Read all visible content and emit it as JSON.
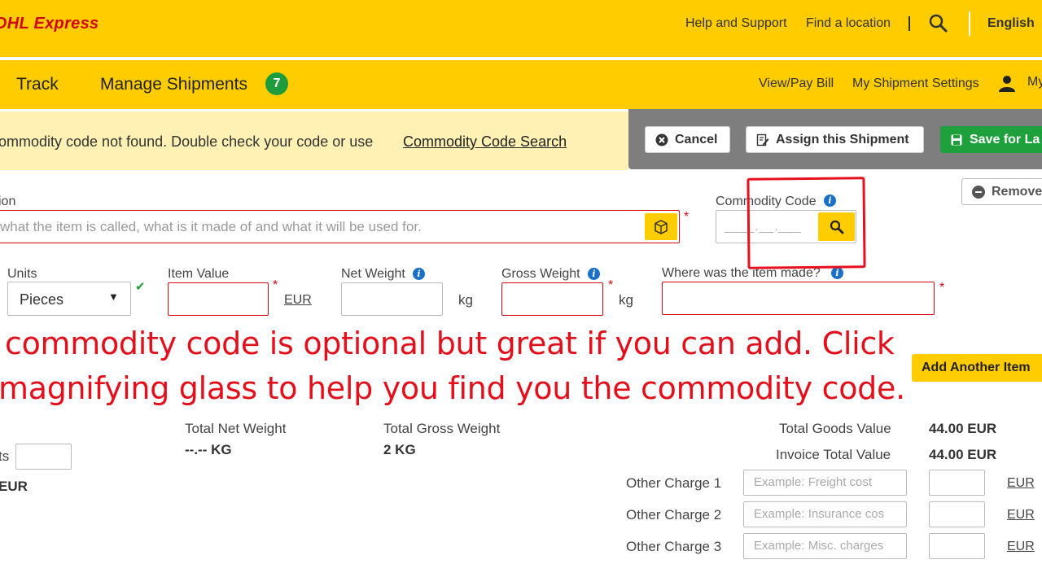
{
  "header": {
    "logo": "DHL Express",
    "links": [
      "Help and Support",
      "Find a location"
    ],
    "language": "English"
  },
  "nav": {
    "track": "Track",
    "manage": "Manage Shipments",
    "manage_count": "7",
    "view_pay_bill": "View/Pay Bill",
    "shipment_settings": "My Shipment Settings",
    "account": "My"
  },
  "alert": {
    "text": "ommodity code not found. Double check your code or use",
    "link": "Commodity Code Search"
  },
  "actions": {
    "cancel": "Cancel",
    "assign": "Assign this Shipment",
    "save": "Save for La"
  },
  "form": {
    "description_label": "ion",
    "description_placeholder": "what the item is called, what is it made of and what it will be used for.",
    "commodity_label": "Commodity Code",
    "commodity_placeholder": "____.__.___",
    "remove": "Remove",
    "units_label": "Units",
    "units_value": "Pieces",
    "item_value_label": "Item Value",
    "item_value_currency": "EUR",
    "net_weight_label": "Net Weight",
    "net_weight_unit": "kg",
    "gross_weight_label": "Gross Weight",
    "gross_weight_unit": "kg",
    "origin_label": "Where was the item made?",
    "add_item": "Add Another Item"
  },
  "annotation": {
    "line1": "commodity code is optional but great if you can add. Click",
    "line2": "magnifying glass to help you find you the commodity code."
  },
  "totals": {
    "units_label": "ts",
    "left_value": "EUR",
    "net_weight_label": "Total Net Weight",
    "net_weight_value": "--.-- KG",
    "gross_weight_label": "Total Gross Weight",
    "gross_weight_value": "2 KG",
    "goods_value_label": "Total Goods Value",
    "goods_value": "44.00 EUR",
    "invoice_total_label": "Invoice Total Value",
    "invoice_total": "44.00 EUR"
  },
  "charges": [
    {
      "label": "Other Charge 1",
      "placeholder": "Example: Freight cost",
      "currency": "EUR"
    },
    {
      "label": "Other Charge 2",
      "placeholder": "Example: Insurance cos",
      "currency": "EUR"
    },
    {
      "label": "Other Charge 3",
      "placeholder": "Example: Misc. charges",
      "currency": "EUR"
    }
  ],
  "colors": {
    "brand_yellow": "#FFCC00",
    "brand_red": "#D40511",
    "badge_green": "#1E9B3A",
    "info_blue": "#1A6FC9",
    "annotation_red": "#E3101C"
  }
}
